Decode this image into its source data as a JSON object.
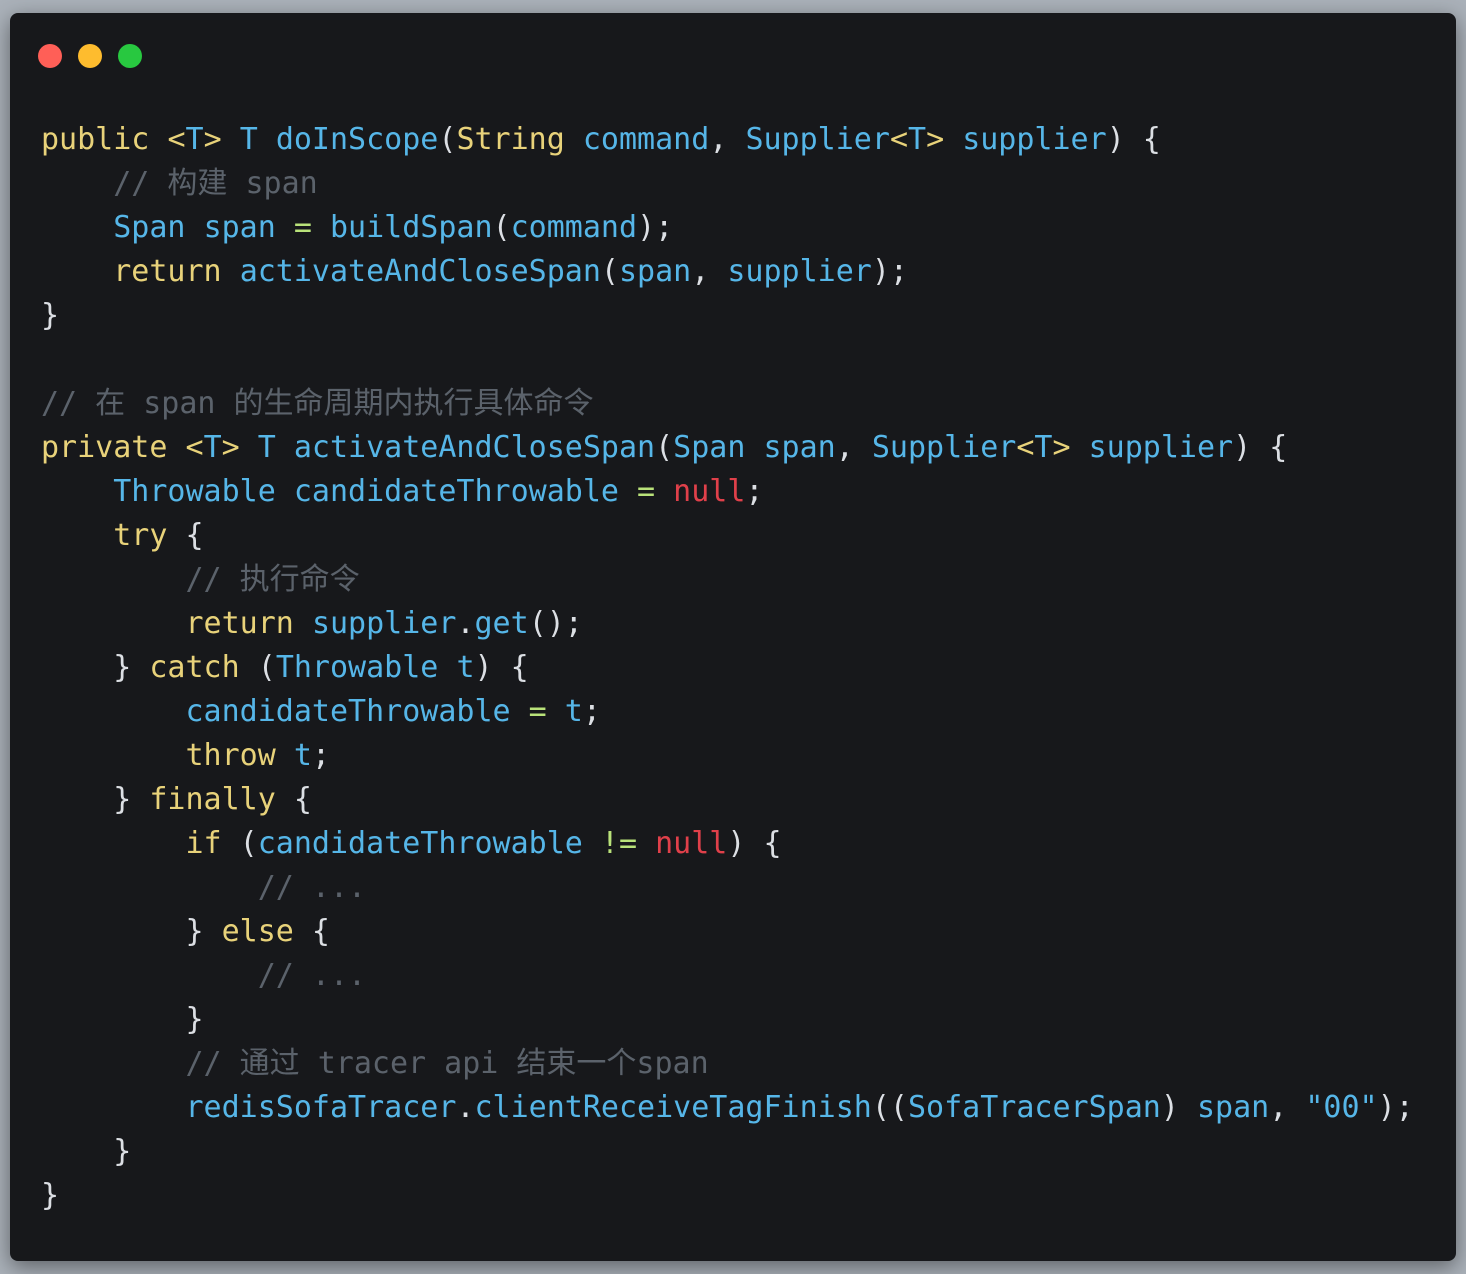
{
  "window": {
    "controls": [
      {
        "name": "close",
        "color": "#ff5f57"
      },
      {
        "name": "minimize",
        "color": "#febc2e"
      },
      {
        "name": "zoom",
        "color": "#28c840"
      }
    ]
  },
  "code": {
    "language": "java",
    "lines": [
      [
        [
          "kw",
          "public"
        ],
        [
          "pn",
          " "
        ],
        [
          "kw",
          "<"
        ],
        [
          "ty",
          "T"
        ],
        [
          "kw",
          ">"
        ],
        [
          "pn",
          " "
        ],
        [
          "ty",
          "T"
        ],
        [
          "pn",
          " "
        ],
        [
          "fn",
          "doInScope"
        ],
        [
          "pn",
          "("
        ],
        [
          "kw",
          "String"
        ],
        [
          "pn",
          " "
        ],
        [
          "id",
          "command"
        ],
        [
          "pn",
          ", "
        ],
        [
          "ty",
          "Supplier"
        ],
        [
          "kw",
          "<"
        ],
        [
          "ty",
          "T"
        ],
        [
          "kw",
          ">"
        ],
        [
          "pn",
          " "
        ],
        [
          "id",
          "supplier"
        ],
        [
          "pn",
          ") {"
        ]
      ],
      [
        [
          "pn",
          "    "
        ],
        [
          "cm",
          "// 构建 span"
        ]
      ],
      [
        [
          "pn",
          "    "
        ],
        [
          "ty",
          "Span"
        ],
        [
          "pn",
          " "
        ],
        [
          "id",
          "span"
        ],
        [
          "pn",
          " "
        ],
        [
          "op",
          "="
        ],
        [
          "pn",
          " "
        ],
        [
          "fn",
          "buildSpan"
        ],
        [
          "pn",
          "("
        ],
        [
          "id",
          "command"
        ],
        [
          "pn",
          ");"
        ]
      ],
      [
        [
          "pn",
          "    "
        ],
        [
          "kw",
          "return"
        ],
        [
          "pn",
          " "
        ],
        [
          "fn",
          "activateAndCloseSpan"
        ],
        [
          "pn",
          "("
        ],
        [
          "id",
          "span"
        ],
        [
          "pn",
          ", "
        ],
        [
          "id",
          "supplier"
        ],
        [
          "pn",
          ");"
        ]
      ],
      [
        [
          "pn",
          "}"
        ]
      ],
      [],
      [
        [
          "cm",
          "// 在 span 的生命周期内执行具体命令"
        ]
      ],
      [
        [
          "kw",
          "private"
        ],
        [
          "pn",
          " "
        ],
        [
          "kw",
          "<"
        ],
        [
          "ty",
          "T"
        ],
        [
          "kw",
          ">"
        ],
        [
          "pn",
          " "
        ],
        [
          "ty",
          "T"
        ],
        [
          "pn",
          " "
        ],
        [
          "fn",
          "activateAndCloseSpan"
        ],
        [
          "pn",
          "("
        ],
        [
          "ty",
          "Span"
        ],
        [
          "pn",
          " "
        ],
        [
          "id",
          "span"
        ],
        [
          "pn",
          ", "
        ],
        [
          "ty",
          "Supplier"
        ],
        [
          "kw",
          "<"
        ],
        [
          "ty",
          "T"
        ],
        [
          "kw",
          ">"
        ],
        [
          "pn",
          " "
        ],
        [
          "id",
          "supplier"
        ],
        [
          "pn",
          ") {"
        ]
      ],
      [
        [
          "pn",
          "    "
        ],
        [
          "ty",
          "Throwable"
        ],
        [
          "pn",
          " "
        ],
        [
          "id",
          "candidateThrowable"
        ],
        [
          "pn",
          " "
        ],
        [
          "op",
          "="
        ],
        [
          "pn",
          " "
        ],
        [
          "nl",
          "null"
        ],
        [
          "pn",
          ";"
        ]
      ],
      [
        [
          "pn",
          "    "
        ],
        [
          "kw",
          "try"
        ],
        [
          "pn",
          " {"
        ]
      ],
      [
        [
          "pn",
          "        "
        ],
        [
          "cm",
          "// 执行命令"
        ]
      ],
      [
        [
          "pn",
          "        "
        ],
        [
          "kw",
          "return"
        ],
        [
          "pn",
          " "
        ],
        [
          "id",
          "supplier"
        ],
        [
          "pn",
          "."
        ],
        [
          "fn",
          "get"
        ],
        [
          "pn",
          "();"
        ]
      ],
      [
        [
          "pn",
          "    } "
        ],
        [
          "kw",
          "catch"
        ],
        [
          "pn",
          " ("
        ],
        [
          "ty",
          "Throwable"
        ],
        [
          "pn",
          " "
        ],
        [
          "id",
          "t"
        ],
        [
          "pn",
          ") {"
        ]
      ],
      [
        [
          "pn",
          "        "
        ],
        [
          "id",
          "candidateThrowable"
        ],
        [
          "pn",
          " "
        ],
        [
          "op",
          "="
        ],
        [
          "pn",
          " "
        ],
        [
          "id",
          "t"
        ],
        [
          "pn",
          ";"
        ]
      ],
      [
        [
          "pn",
          "        "
        ],
        [
          "kw",
          "throw"
        ],
        [
          "pn",
          " "
        ],
        [
          "id",
          "t"
        ],
        [
          "pn",
          ";"
        ]
      ],
      [
        [
          "pn",
          "    } "
        ],
        [
          "kw",
          "finally"
        ],
        [
          "pn",
          " {"
        ]
      ],
      [
        [
          "pn",
          "        "
        ],
        [
          "kw",
          "if"
        ],
        [
          "pn",
          " ("
        ],
        [
          "id",
          "candidateThrowable"
        ],
        [
          "pn",
          " "
        ],
        [
          "op",
          "!="
        ],
        [
          "pn",
          " "
        ],
        [
          "nl",
          "null"
        ],
        [
          "pn",
          ") {"
        ]
      ],
      [
        [
          "pn",
          "            "
        ],
        [
          "cm",
          "// ..."
        ]
      ],
      [
        [
          "pn",
          "        } "
        ],
        [
          "kw",
          "else"
        ],
        [
          "pn",
          " {"
        ]
      ],
      [
        [
          "pn",
          "            "
        ],
        [
          "cm",
          "// ..."
        ]
      ],
      [
        [
          "pn",
          "        }"
        ]
      ],
      [
        [
          "pn",
          "        "
        ],
        [
          "cm",
          "// 通过 tracer api 结束一个span"
        ]
      ],
      [
        [
          "pn",
          "        "
        ],
        [
          "id",
          "redisSofaTracer"
        ],
        [
          "pn",
          "."
        ],
        [
          "fn",
          "clientReceiveTagFinish"
        ],
        [
          "pn",
          "(("
        ],
        [
          "ty",
          "SofaTracerSpan"
        ],
        [
          "pn",
          ") "
        ],
        [
          "id",
          "span"
        ],
        [
          "pn",
          ", "
        ],
        [
          "str",
          "\"00\""
        ],
        [
          "pn",
          ");"
        ]
      ],
      [
        [
          "pn",
          "    }"
        ]
      ],
      [
        [
          "pn",
          "}"
        ]
      ]
    ]
  }
}
